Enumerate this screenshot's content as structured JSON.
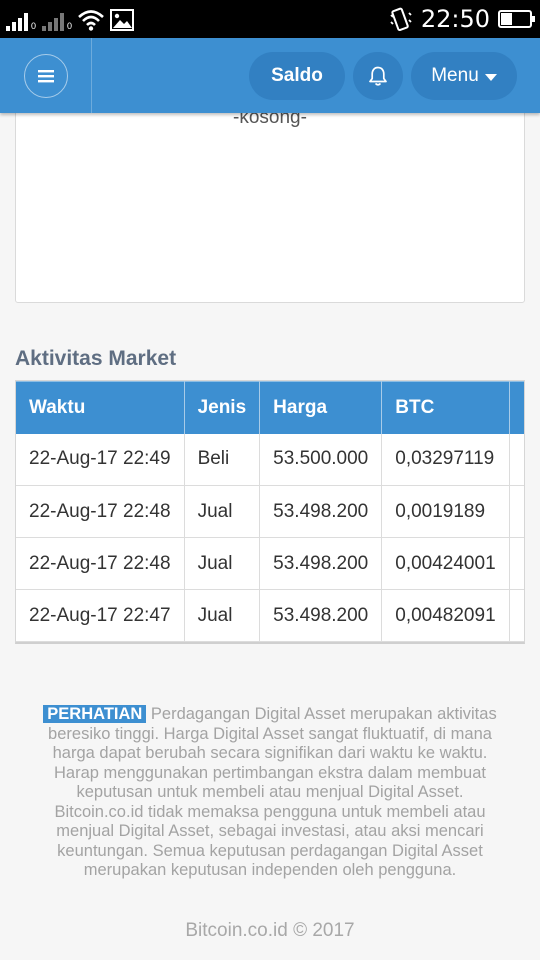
{
  "statusbar": {
    "time": "22:50",
    "sim1_tag": "0",
    "sim2_tag": "0",
    "battery_level": 0.35
  },
  "appbar": {
    "saldo_label": "Saldo",
    "menu_label": "Menu"
  },
  "empty_card": {
    "text": "-kosong-"
  },
  "market": {
    "title": "Aktivitas Market",
    "columns": [
      "Waktu",
      "Jenis",
      "Harga",
      "BTC"
    ],
    "rows": [
      [
        "22-Aug-17 22:49",
        "Beli",
        "53.500.000",
        "0,03297119"
      ],
      [
        "22-Aug-17 22:48",
        "Jual",
        "53.498.200",
        "0,0019189"
      ],
      [
        "22-Aug-17 22:48",
        "Jual",
        "53.498.200",
        "0,00424001"
      ],
      [
        "22-Aug-17 22:47",
        "Jual",
        "53.498.200",
        "0,00482091"
      ]
    ]
  },
  "footer": {
    "badge": "PERHATIAN",
    "disclaimer": "Perdagangan Digital Asset merupakan aktivitas beresiko tinggi. Harga Digital Asset sangat fluktuatif, di mana harga dapat berubah secara signifikan dari waktu ke waktu. Harap menggunakan pertimbangan ekstra dalam membuat keputusan untuk membeli atau menjual Digital Asset. Bitcoin.co.id tidak memaksa pengguna untuk membeli atau menjual Digital Asset, sebagai investasi, atau aksi mencari keuntungan. Semua keputusan perdagangan Digital Asset merupakan keputusan independen oleh pengguna.",
    "copyright": "Bitcoin.co.id © 2017"
  }
}
